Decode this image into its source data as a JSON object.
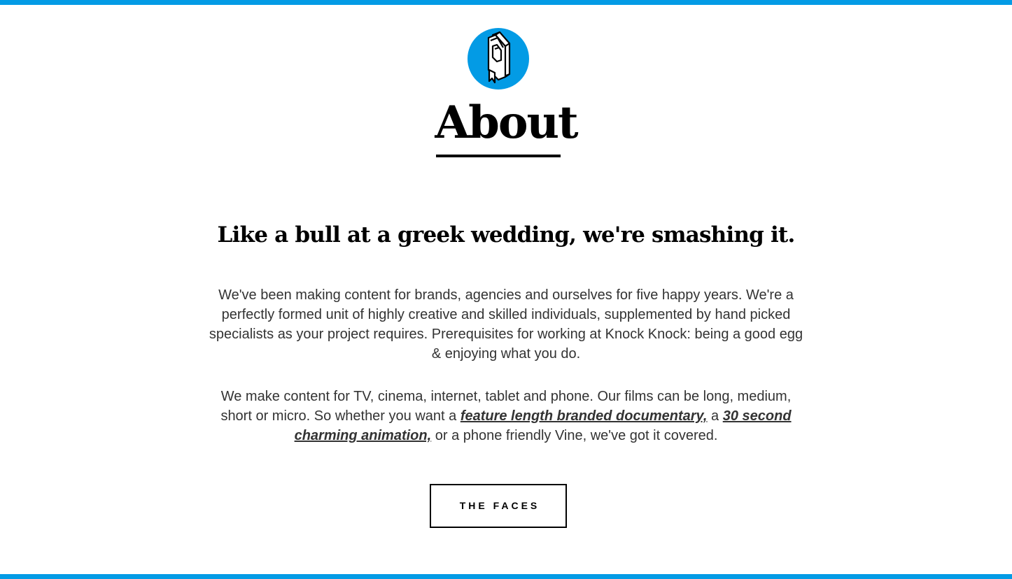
{
  "colors": {
    "accent": "#039be5",
    "heading": "#000000",
    "body_text": "#333333",
    "background": "#ffffff"
  },
  "header": {
    "logo_icon": "book-bookmark-icon",
    "title": "About"
  },
  "main": {
    "tagline": "Like a bull at a greek wedding, we're smashing it.",
    "paragraph1": "We've been making content for brands, agencies and ourselves for five happy years. We're a perfectly formed unit of highly creative and skilled individuals, supplemented by hand picked specialists as your project requires. Prerequisites for working at Knock Knock: being a good egg & enjoying what you do.",
    "paragraph2": {
      "text_before": "We make content for TV, cinema, internet, tablet and phone. Our films can be long, medium, short or micro. So whether you want a ",
      "link1": "feature length branded documentary,",
      "text_middle": " a ",
      "link2": "30 second charming animation,",
      "text_after": " or a phone friendly Vine, we've got it covered."
    },
    "button_label": "THE FACES"
  }
}
